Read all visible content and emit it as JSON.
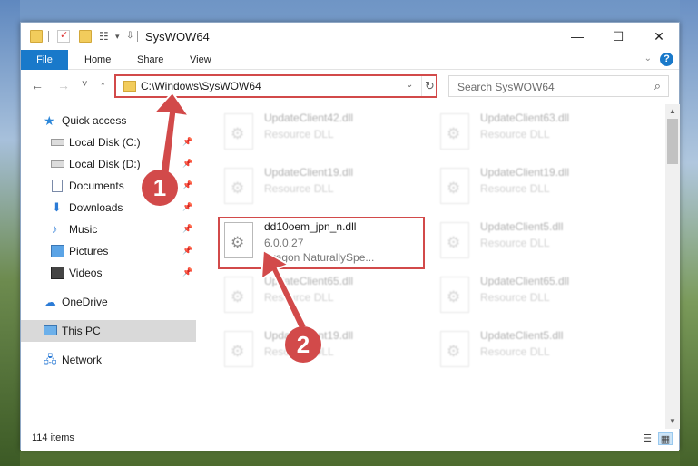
{
  "window": {
    "title": "SysWOW64",
    "minimize": "—",
    "maximize": "☐",
    "close": "✕"
  },
  "ribbon": {
    "file": "File",
    "tabs": [
      "Home",
      "Share",
      "View"
    ],
    "help": "?"
  },
  "navbar": {
    "back": "←",
    "forward": "→",
    "recent": "˅",
    "up": "↑",
    "address": "C:\\Windows\\SysWOW64",
    "refresh": "↻",
    "search_placeholder": "Search SysWOW64"
  },
  "sidebar": {
    "items": [
      {
        "label": "Quick access",
        "icon": "star-icon"
      },
      {
        "label": "Local Disk (C:)",
        "icon": "disk-icon",
        "pinned": true
      },
      {
        "label": "Local Disk (D:)",
        "icon": "disk-icon",
        "pinned": true
      },
      {
        "label": "Documents",
        "icon": "document-icon",
        "pinned": true
      },
      {
        "label": "Downloads",
        "icon": "download-icon",
        "pinned": true
      },
      {
        "label": "Music",
        "icon": "music-icon",
        "pinned": true
      },
      {
        "label": "Pictures",
        "icon": "pictures-icon",
        "pinned": true
      },
      {
        "label": "Videos",
        "icon": "video-icon",
        "pinned": true
      },
      {
        "label": "OneDrive",
        "icon": "cloud-icon"
      },
      {
        "label": "This PC",
        "icon": "pc-icon",
        "selected": true
      },
      {
        "label": "Network",
        "icon": "network-icon"
      }
    ]
  },
  "files": [
    {
      "name": "UpdateClient42.dll",
      "type": "Resource DLL",
      "faded": true
    },
    {
      "name": "UpdateClient63.dll",
      "type": "Resource DLL",
      "faded": true
    },
    {
      "name": "UpdateClient19.dll",
      "type": "Resource DLL",
      "faded": true
    },
    {
      "name": "UpdateClient19.dll",
      "type": "Resource DLL",
      "faded": true
    },
    {
      "name": "dd10oem_jpn_n.dll",
      "version": "6.0.0.27",
      "company": "Dragon NaturallySpe...",
      "faded": false
    },
    {
      "name": "UpdateClient5.dll",
      "type": "Resource DLL",
      "faded": true
    },
    {
      "name": "UpdateClient65.dll",
      "type": "Resource DLL",
      "faded": true
    },
    {
      "name": "UpdateClient65.dll",
      "type": "Resource DLL",
      "faded": true
    },
    {
      "name": "UpdateClient19.dll",
      "type": "Resource DLL",
      "faded": true
    },
    {
      "name": "UpdateClient5.dll",
      "type": "Resource DLL",
      "faded": true
    }
  ],
  "status": {
    "items_count": "114 items"
  },
  "annotations": {
    "step1": "1",
    "step2": "2"
  },
  "colors": {
    "accent": "#1979ca",
    "highlight": "#d24a4a",
    "selected_bg": "#d9d9d9"
  }
}
